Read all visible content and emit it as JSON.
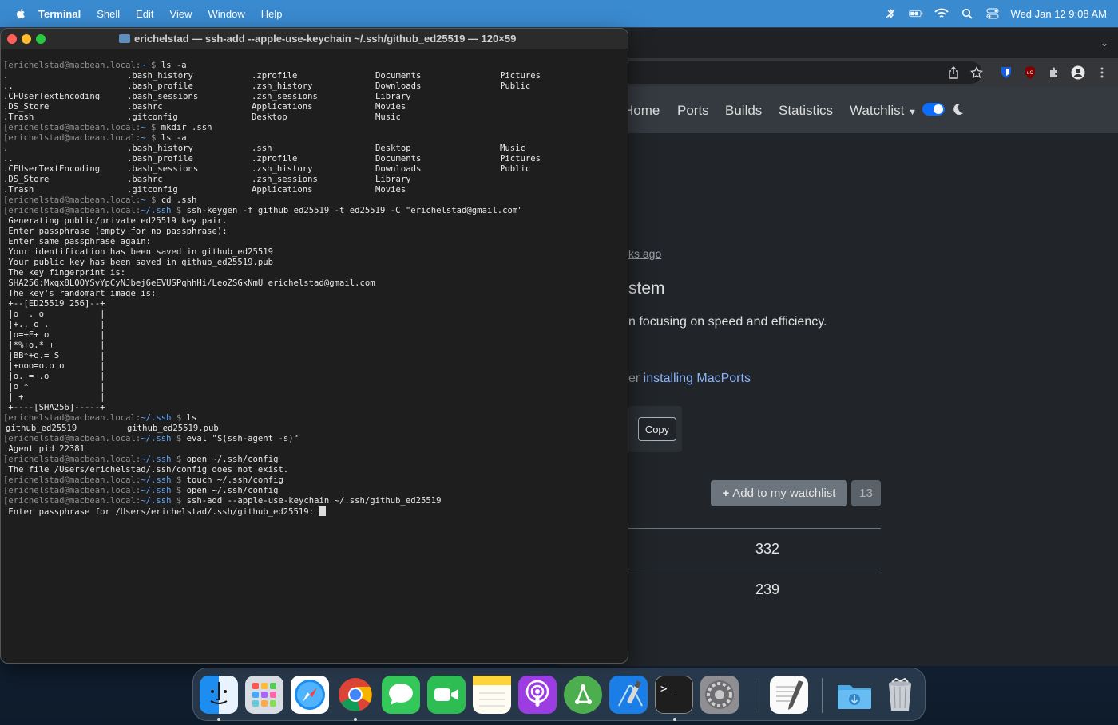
{
  "menubar": {
    "app_name": "Terminal",
    "items": [
      "Shell",
      "Edit",
      "View",
      "Window",
      "Help"
    ],
    "clock": "Wed Jan 12  9:08 AM",
    "status_icons": [
      "bluetooth-muted-icon",
      "battery-icon",
      "wifi-icon",
      "spotlight-search-icon",
      "control-center-icon"
    ]
  },
  "terminal": {
    "title": "erichelstad — ssh-add --apple-use-keychain ~/.ssh/github_ed25519 — 120×59",
    "prompt_home": "[erichelstad@macbean.local:",
    "prompt_ssh_path": "~/.ssh",
    "prompt_tilde": "~",
    "prompt_suffix": " $ ",
    "cmd1": "ls -a",
    "ls1": {
      "col1": [
        ".",
        "..",
        ".CFUserTextEncoding",
        ".DS_Store",
        ".Trash"
      ],
      "col2": [
        ".bash_history",
        ".bash_profile",
        ".bash_sessions",
        ".bashrc",
        ".gitconfig"
      ],
      "col3": [
        ".zprofile",
        ".zsh_history",
        ".zsh_sessions",
        "Applications",
        "Desktop"
      ],
      "col4": [
        "Documents",
        "Downloads",
        "Library",
        "Movies",
        "Music"
      ],
      "col5": [
        "Pictures",
        "Public",
        "",
        "",
        ""
      ]
    },
    "cmd2": "mkdir .ssh",
    "cmd3": "ls -a",
    "ls2": {
      "col1": [
        ".",
        "..",
        ".CFUserTextEncoding",
        ".DS_Store",
        ".Trash"
      ],
      "col2": [
        ".bash_history",
        ".bash_profile",
        ".bash_sessions",
        ".bashrc",
        ".gitconfig"
      ],
      "col3": [
        ".ssh",
        ".zprofile",
        ".zsh_history",
        ".zsh_sessions",
        "Applications"
      ],
      "col4": [
        "Desktop",
        "Documents",
        "Downloads",
        "Library",
        "Movies"
      ],
      "col5": [
        "Music",
        "Pictures",
        "Public",
        "",
        ""
      ]
    },
    "cmd4": "cd .ssh",
    "cmd5": "ssh-keygen -f github_ed25519 -t ed25519 -C \"erichelstad@gmail.com\"",
    "keygen_output": [
      " Generating public/private ed25519 key pair.",
      " Enter passphrase (empty for no passphrase):",
      " Enter same passphrase again:",
      " Your identification has been saved in github_ed25519",
      " Your public key has been saved in github_ed25519.pub",
      " The key fingerprint is:",
      " SHA256:Mxqx8LQOYSvYpCyNJbej6eEVUSPqhhHi/LeoZSGkNmU erichelstad@gmail.com",
      " The key's randomart image is:",
      " +--[ED25519 256]--+",
      " |o  . o           |",
      " |+.. o .          |",
      " |o=+E+ o          |",
      " |*%+o.* +         |",
      " |BB*+o.= S        |",
      " |+ooo=o.o o       |",
      " |o. = .o          |",
      " |o *              |",
      " | +               |",
      " +----[SHA256]-----+"
    ],
    "cmd6": "ls",
    "ls3": [
      "github_ed25519",
      "github_ed25519.pub"
    ],
    "cmd7": "eval \"$(ssh-agent -s)\"",
    "agent_output": " Agent pid 22381",
    "cmd8": "open ~/.ssh/config",
    "config_error": " The file /Users/erichelstad/.ssh/config does not exist.",
    "cmd9": "touch ~/.ssh/config",
    "cmd10": "open ~/.ssh/config",
    "cmd11": "ssh-add --apple-use-keychain ~/.ssh/github_ed25519",
    "passphrase_prompt": " Enter passphrase for /Users/erichelstad/.ssh/github_ed25519: "
  },
  "browser": {
    "nav": {
      "home": "Home",
      "ports": "Ports",
      "builds": "Builds",
      "statistics": "Statistics",
      "watchlist": "Watchlist"
    },
    "weeks_ago": "ks ago",
    "heading_fragment": "stem",
    "description_fragment": "n focusing on speed and efficiency.",
    "install_prefix": "er ",
    "install_link": "installing MacPorts",
    "copy_label": "Copy",
    "watchlist_button": "Add to my watchlist",
    "watch_count": "13",
    "stat_values": [
      "332",
      "239"
    ]
  },
  "dock": {
    "apps": [
      "finder-icon",
      "launchpad-icon",
      "safari-icon",
      "chrome-icon",
      "messages-icon",
      "facetime-icon",
      "notes-icon",
      "podcasts-icon",
      "git-app-icon",
      "xcode-icon",
      "terminal-icon",
      "system-preferences-icon",
      "textedit-icon",
      "downloads-folder-icon",
      "trash-icon"
    ]
  },
  "colors": {
    "menubar": "#3a8ad0",
    "terminal_bg": "#1e1e1e",
    "prompt_path": "#5fa3ff",
    "browser_bg": "#212529",
    "accent": "#0d6efd"
  }
}
